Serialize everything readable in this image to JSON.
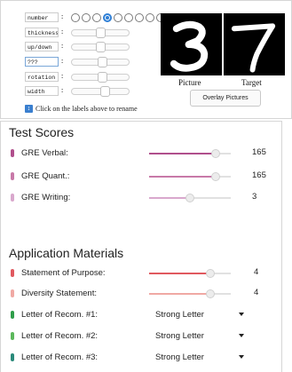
{
  "controls": [
    {
      "label": "number",
      "kind": "radio",
      "options": 10,
      "selected": 3
    },
    {
      "label": "thickness",
      "kind": "slider",
      "value": 0.5
    },
    {
      "label": "up/down",
      "kind": "slider",
      "value": 0.5
    },
    {
      "label": "???",
      "kind": "slider",
      "value": 0.55
    },
    {
      "label": "rotation",
      "kind": "slider",
      "value": 0.55
    },
    {
      "label": "width",
      "kind": "slider",
      "value": 0.6
    }
  ],
  "images": {
    "picture_caption": "Picture",
    "target_caption": "Target",
    "picture_digit": "3",
    "target_digit": "7"
  },
  "overlay_button": "Overlay Pictures",
  "hint_text": "Click on the labels above to rename",
  "sections": {
    "test_scores_title": "Test Scores",
    "application_title": "Application Materials"
  },
  "test_scores": [
    {
      "label": "GRE Verbal:",
      "value": "165",
      "level": 0.82,
      "color": "#b04f8c"
    },
    {
      "label": "GRE Quant.:",
      "value": "165",
      "level": 0.82,
      "color": "#c879a8"
    },
    {
      "label": "GRE Writing:",
      "value": "3",
      "level": 0.5,
      "color": "#d9a8cd"
    }
  ],
  "materials_sliders": [
    {
      "label": "Statement of Purpose:",
      "value": "4",
      "level": 0.75,
      "color": "#e0595f"
    },
    {
      "label": "Diversity Statement:",
      "value": "4",
      "level": 0.75,
      "color": "#f0a9a4"
    }
  ],
  "materials_dropdowns": [
    {
      "label": "Letter of Recom. #1:",
      "value": "Strong Letter",
      "color": "#2f9e4a"
    },
    {
      "label": "Letter of Recom. #2:",
      "value": "Strong Letter",
      "color": "#5cb85c"
    },
    {
      "label": "Letter of Recom. #3:",
      "value": "Strong Letter",
      "color": "#2a8a7a"
    }
  ]
}
